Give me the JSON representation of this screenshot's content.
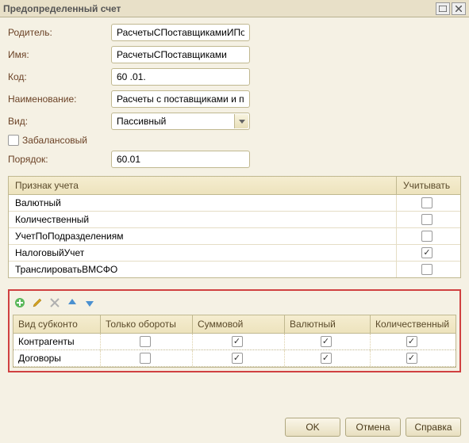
{
  "window": {
    "title": "Предопределенный счет"
  },
  "form": {
    "parent_label": "Родитель:",
    "parent_value": "РасчетыСПоставщикамиИПодрядчик",
    "name_label": "Имя:",
    "name_value": "РасчетыСПоставщиками",
    "code_label": "Код:",
    "code_value": "60 .01.",
    "desc_label": "Наименование:",
    "desc_value": "Расчеты с поставщиками и подрядчи",
    "kind_label": "Вид:",
    "kind_value": "Пассивный",
    "offbalance_label": "Забалансовый",
    "order_label": "Порядок:",
    "order_value": "60.01"
  },
  "grid1": {
    "header_col1": "Признак учета",
    "header_col2": "Учитывать",
    "rows": [
      {
        "label": "Валютный",
        "checked": false
      },
      {
        "label": "Количественный",
        "checked": false
      },
      {
        "label": "УчетПоПодразделениям",
        "checked": false
      },
      {
        "label": "НалоговыйУчет",
        "checked": true
      },
      {
        "label": "ТранслироватьВМСФО",
        "checked": false
      }
    ]
  },
  "grid2": {
    "headers": [
      "Вид субконто",
      "Только обороты",
      "Суммовой",
      "Валютный",
      "Количественный"
    ],
    "rows": [
      {
        "label": "Контрагенты",
        "cells": [
          false,
          true,
          true,
          true
        ]
      },
      {
        "label": "Договоры",
        "cells": [
          false,
          true,
          true,
          true
        ]
      }
    ]
  },
  "footer": {
    "ok": "OK",
    "cancel": "Отмена",
    "help": "Справка"
  }
}
